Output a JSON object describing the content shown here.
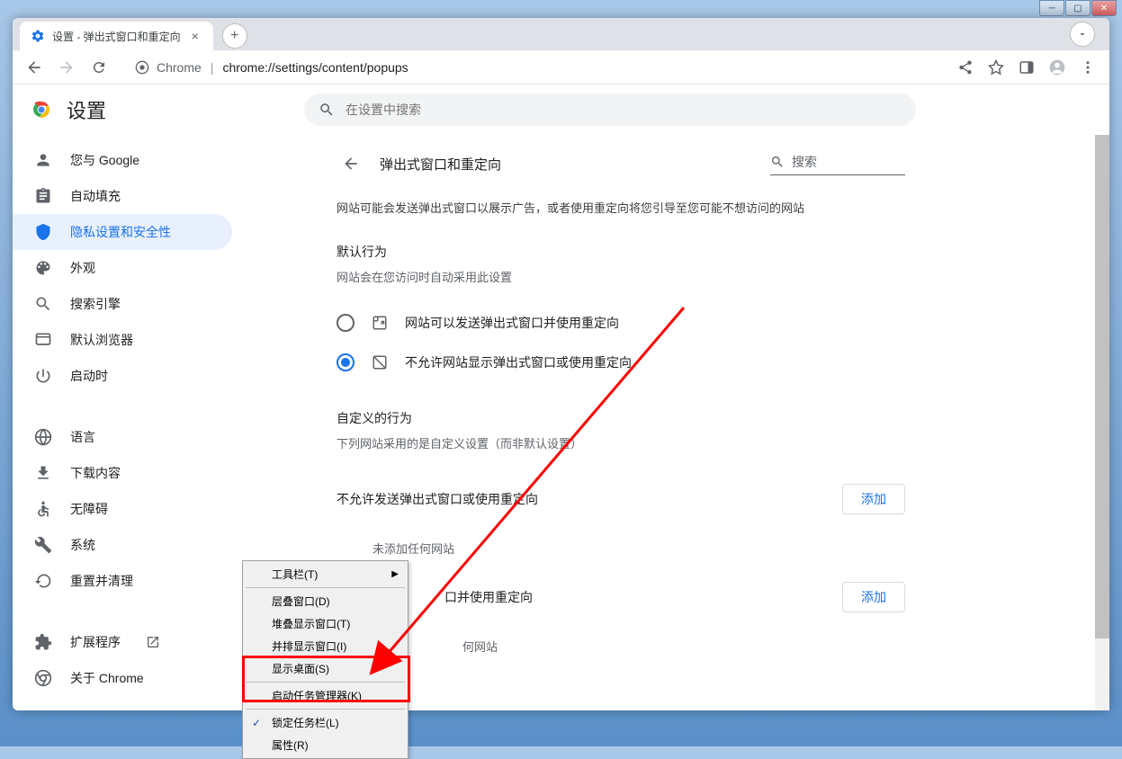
{
  "tab": {
    "title": "设置 - 弹出式窗口和重定向"
  },
  "omnibox": {
    "prefix": "Chrome",
    "url": "chrome://settings/content/popups"
  },
  "settings": {
    "title": "设置",
    "search_placeholder": "在设置中搜索"
  },
  "sidebar": {
    "items": [
      {
        "label": "您与 Google"
      },
      {
        "label": "自动填充"
      },
      {
        "label": "隐私设置和安全性"
      },
      {
        "label": "外观"
      },
      {
        "label": "搜索引擎"
      },
      {
        "label": "默认浏览器"
      },
      {
        "label": "启动时"
      },
      {
        "label": "语言"
      },
      {
        "label": "下载内容"
      },
      {
        "label": "无障碍"
      },
      {
        "label": "系统"
      },
      {
        "label": "重置并清理"
      }
    ],
    "extensions": "扩展程序",
    "about": "关于 Chrome"
  },
  "main": {
    "back_title": "弹出式窗口和重定向",
    "search": "搜索",
    "description": "网站可能会发送弹出式窗口以展示广告，或者使用重定向将您引导至您可能不想访问的网站",
    "default_behavior": "默认行为",
    "default_note": "网站会在您访问时自动采用此设置",
    "opt_allow": "网站可以发送弹出式窗口并使用重定向",
    "opt_block": "不允许网站显示弹出式窗口或使用重定向",
    "custom_behavior": "自定义的行为",
    "custom_note": "下列网站采用的是自定义设置（而非默认设置）",
    "block_section": "不允许发送弹出式窗口或使用重定向",
    "allow_section_partial": "口并使用重定向",
    "add": "添加",
    "none_added": "未添加任何网站",
    "none_added2_partial": "何网站"
  },
  "context_menu": {
    "toolbar": "工具栏(T)",
    "cascade": "层叠窗口(D)",
    "stack": "堆叠显示窗口(T)",
    "side": "并排显示窗口(I)",
    "desktop": "显示桌面(S)",
    "taskmgr": "启动任务管理器(K)",
    "lock": "锁定任务栏(L)",
    "props": "属性(R)"
  }
}
